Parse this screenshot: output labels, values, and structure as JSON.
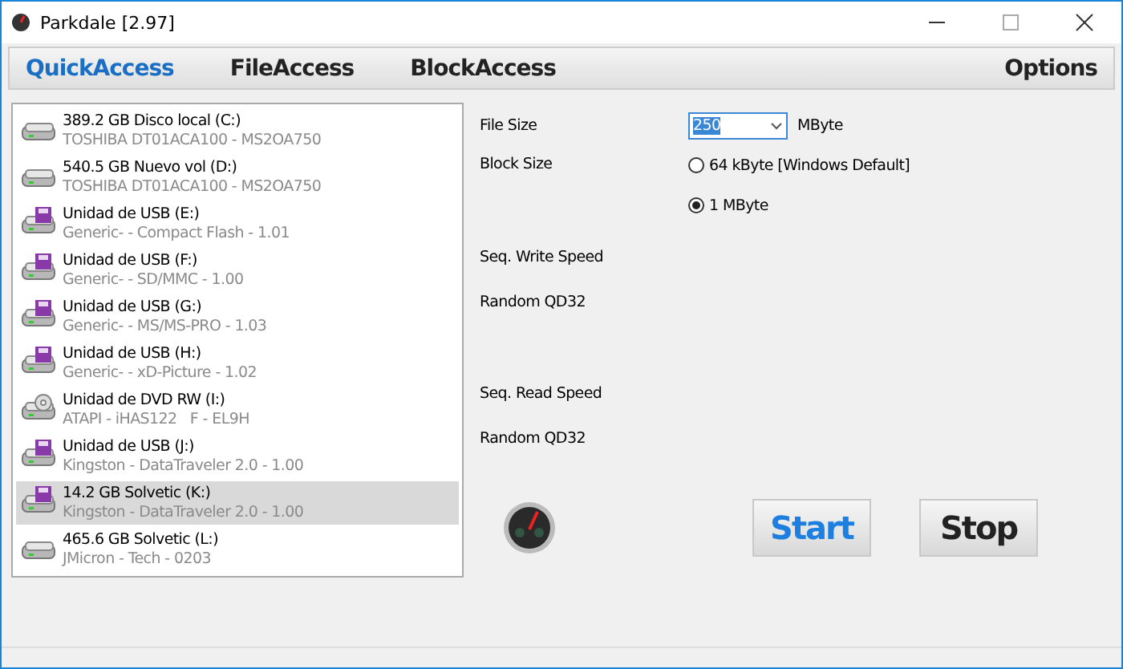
{
  "window": {
    "title": "Parkdale [2.97]"
  },
  "tabs": [
    {
      "label": "QuickAccess",
      "selected": true
    },
    {
      "label": "FileAccess",
      "selected": false
    },
    {
      "label": "BlockAccess",
      "selected": false
    }
  ],
  "options": "Options",
  "drives": [
    {
      "kind": "hdd",
      "name": "389.2 GB Disco local (C:)",
      "detail": "TOSHIBA DT01ACA100 - MS2OA750",
      "selected": false
    },
    {
      "kind": "hdd",
      "name": "540.5 GB Nuevo vol (D:)",
      "detail": "TOSHIBA DT01ACA100 - MS2OA750",
      "selected": false
    },
    {
      "kind": "usb",
      "name": "Unidad de USB (E:)",
      "detail": "Generic- - Compact Flash - 1.01",
      "selected": false
    },
    {
      "kind": "usb",
      "name": "Unidad de USB (F:)",
      "detail": "Generic- - SD/MMC - 1.00",
      "selected": false
    },
    {
      "kind": "usb",
      "name": "Unidad de USB (G:)",
      "detail": "Generic- - MS/MS-PRO - 1.03",
      "selected": false
    },
    {
      "kind": "usb",
      "name": "Unidad de USB (H:)",
      "detail": "Generic- - xD-Picture - 1.02",
      "selected": false
    },
    {
      "kind": "dvd",
      "name": "Unidad de DVD RW (I:)",
      "detail": "ATAPI - iHAS122   F - EL9H",
      "selected": false
    },
    {
      "kind": "usb",
      "name": "Unidad de USB (J:)",
      "detail": "Kingston - DataTraveler 2.0 - 1.00",
      "selected": false
    },
    {
      "kind": "usb",
      "name": "14.2 GB Solvetic (K:)",
      "detail": "Kingston - DataTraveler 2.0 - 1.00",
      "selected": true
    },
    {
      "kind": "hdd",
      "name": "465.6 GB Solvetic (L:)",
      "detail": "JMicron - Tech - 0203",
      "selected": false
    }
  ],
  "file_size": {
    "label": "File Size",
    "value": "250",
    "unit": "MByte"
  },
  "block_size": {
    "label": "Block Size",
    "options": [
      {
        "label": "64 kByte [Windows Default]",
        "selected": false
      },
      {
        "label": "1 MByte",
        "selected": true
      }
    ]
  },
  "results": [
    "Seq. Write Speed",
    "Random QD32",
    "Seq. Read Speed",
    "Random QD32"
  ],
  "buttons": [
    {
      "label": "Start",
      "kind": "primary"
    },
    {
      "label": "Stop",
      "kind": "normal"
    }
  ]
}
